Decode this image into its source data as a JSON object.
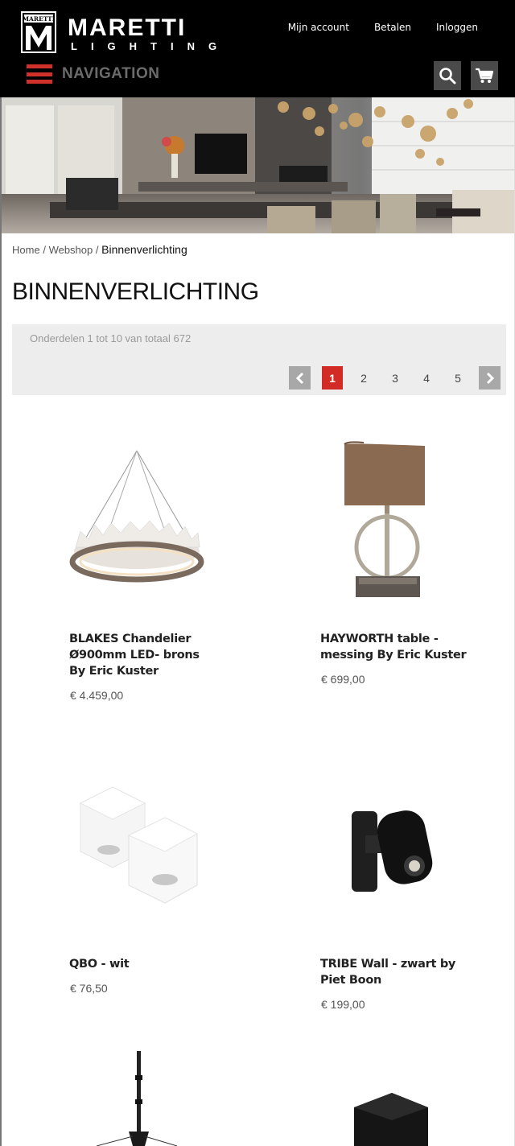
{
  "brand": {
    "logo_text": "MARETTI",
    "logo_sub": "LIGHTING"
  },
  "header": {
    "links": [
      "Mijn account",
      "Betalen",
      "Inloggen"
    ],
    "nav_label": "NAVIGATION",
    "search_icon": "search-icon",
    "cart_icon": "cart-icon"
  },
  "breadcrumb": {
    "items": [
      "Home",
      "Webshop"
    ],
    "current": "Binnenverlichting",
    "separator": "/"
  },
  "page": {
    "title": "BINNENVERLICHTING"
  },
  "toolbar": {
    "count_text": "Onderdelen 1 tot 10 van totaal 672",
    "pages": [
      "1",
      "2",
      "3",
      "4",
      "5"
    ],
    "active_page": "1"
  },
  "products": [
    {
      "name": "BLAKES Chandelier Ø900mm LED- brons By Eric Kuster",
      "price": "€ 4.459,00"
    },
    {
      "name": "HAYWORTH table - messing By Eric Kuster",
      "price": "€ 699,00"
    },
    {
      "name": "QBO - wit",
      "price": "€ 76,50"
    },
    {
      "name": "TRIBE Wall - zwart by Piet Boon",
      "price": "€ 199,00"
    }
  ],
  "colors": {
    "header_bg": "#000000",
    "accent_red": "#d22a25",
    "toolbar_bg": "#ededed",
    "icon_button_bg": "#4a4a4a"
  }
}
